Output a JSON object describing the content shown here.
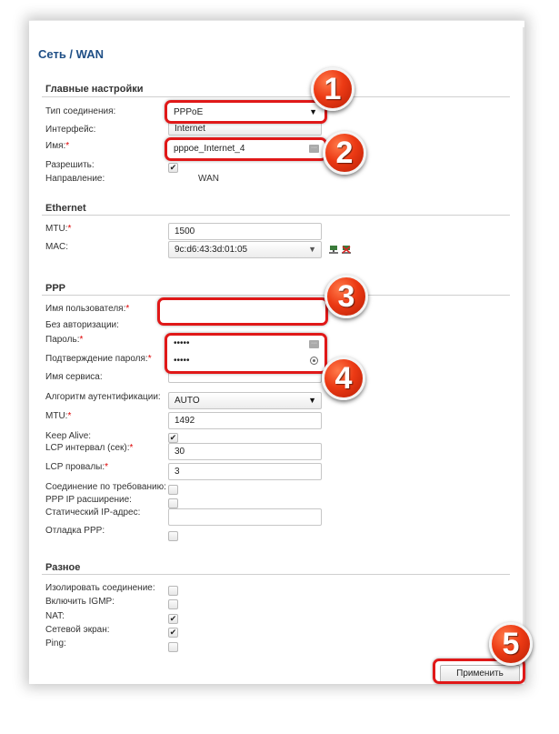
{
  "breadcrumb": "Сеть /  WAN",
  "main_settings": {
    "title": "Главные настройки",
    "conn_type_label": "Тип соединения:",
    "conn_type_value": "PPPoE",
    "interface_label": "Интерфейс:",
    "interface_value": "Internet",
    "name_label": "Имя:",
    "name_value": "pppoe_Internet_4",
    "allow_label": "Разрешить:",
    "direction_label": "Направление:",
    "direction_value": "WAN"
  },
  "ethernet": {
    "title": "Ethernet",
    "mtu_label": "MTU:",
    "mtu_value": "1500",
    "mac_label": "MAC:",
    "mac_value": "9c:d6:43:3d:01:05"
  },
  "ppp": {
    "title": "PPP",
    "username_label": "Имя пользователя:",
    "username_value": "",
    "no_auth_label": "Без авторизации:",
    "password_label": "Пароль:",
    "password_value": "•••••",
    "confirm_label": "Подтверждение пароля:",
    "confirm_value": "•••••",
    "service_label": "Имя сервиса:",
    "service_value": "",
    "auth_alg_label": "Алгоритм аутентификации:",
    "auth_alg_value": "AUTO",
    "mtu_label": "MTU:",
    "mtu_value": "1492",
    "keepalive_label": "Keep Alive:",
    "lcp_interval_label": "LCP интервал (сек):",
    "lcp_interval_value": "30",
    "lcp_fails_label": "LCP провалы:",
    "lcp_fails_value": "3",
    "on_demand_label": "Соединение по требованию:",
    "ip_ext_label": "PPP IP расширение:",
    "static_ip_label": "Статический IP-адрес:",
    "static_ip_value": "",
    "debug_label": "Отладка PPP:"
  },
  "misc": {
    "title": "Разное",
    "isolate_label": "Изолировать соединение:",
    "igmp_label": "Включить IGMP:",
    "nat_label": "NAT:",
    "firewall_label": "Сетевой экран:",
    "ping_label": "Ping:"
  },
  "apply_label": "Применить",
  "checkmark": "✔",
  "callouts": [
    "1",
    "2",
    "3",
    "4",
    "5"
  ],
  "colors": {
    "highlight": "#e01818",
    "badge": "#ec3a14",
    "breadcrumb": "#1f4f86"
  }
}
